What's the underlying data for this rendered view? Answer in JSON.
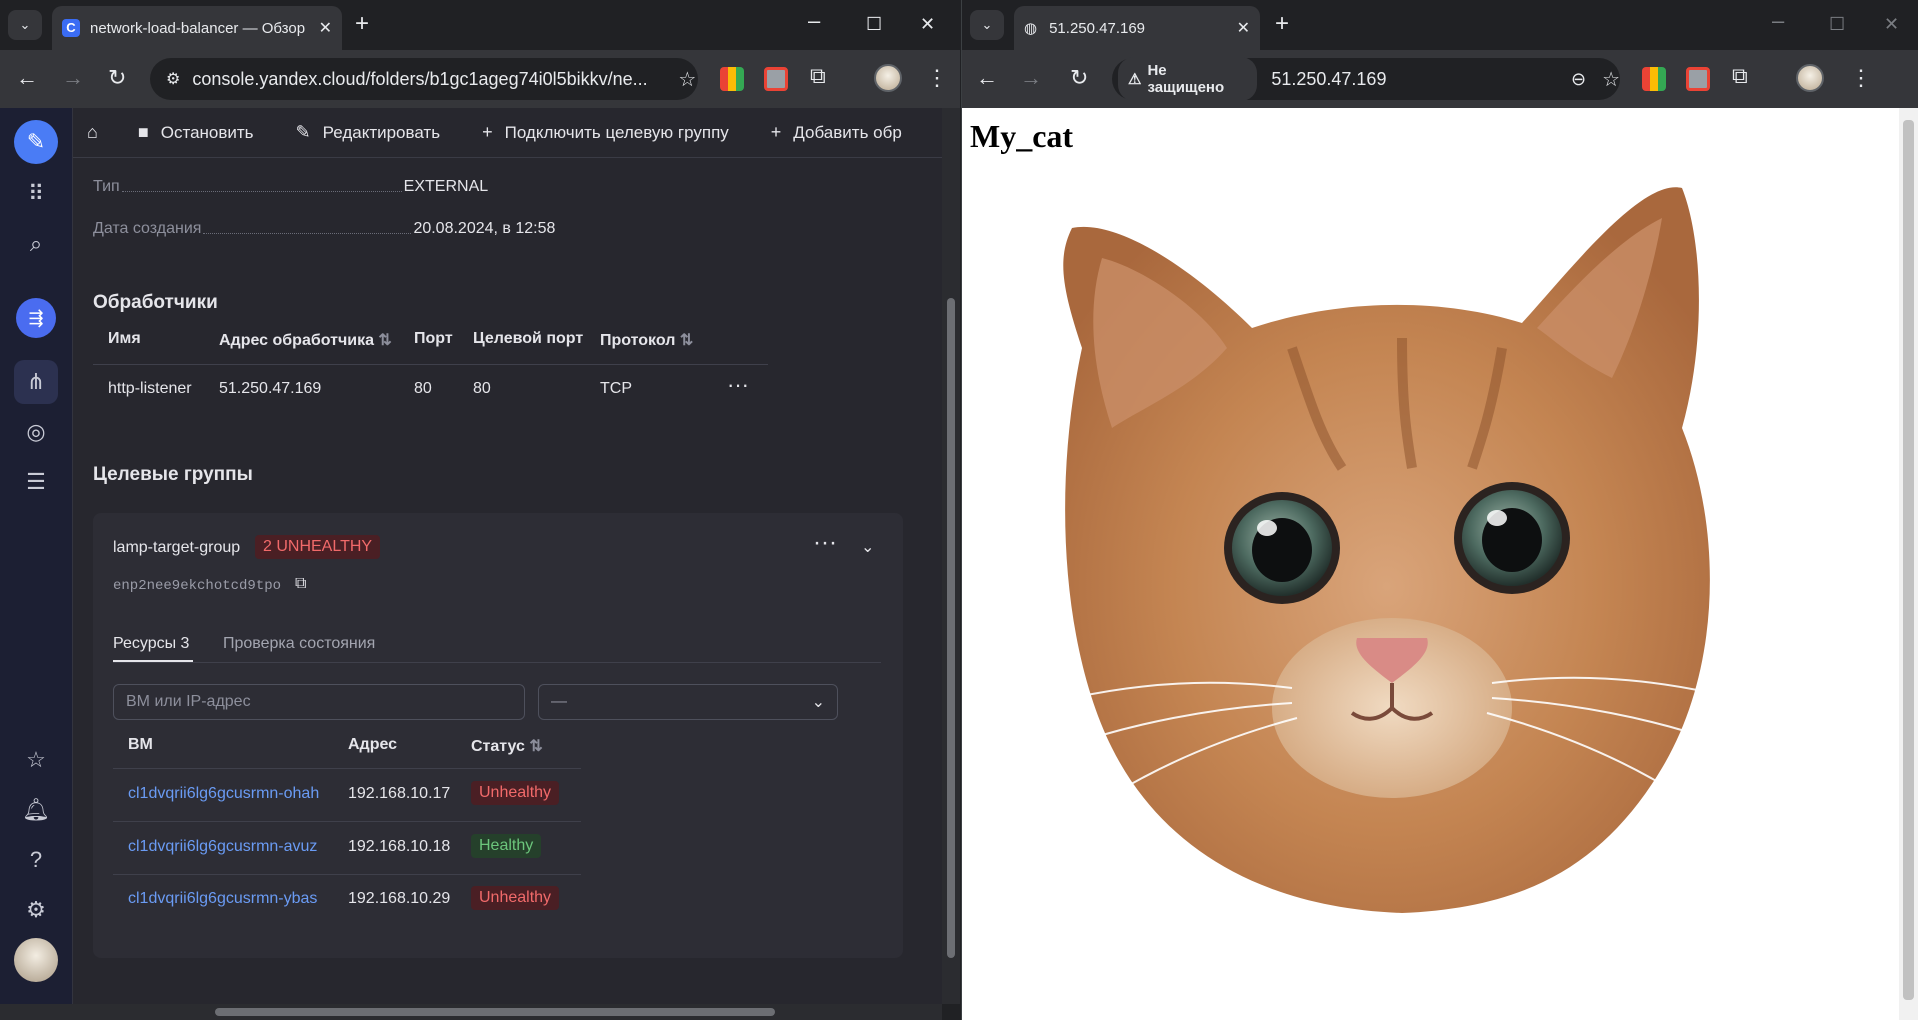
{
  "left_window": {
    "tab_title": "network-load-balancer — Обзор",
    "url": "console.yandex.cloud/folders/b1gc1ageg74i0l5bikkv/ne...",
    "actions": [
      "Остановить",
      "Редактировать",
      "Подключить целевую группу",
      "Добавить обр"
    ],
    "properties": [
      {
        "label": "Тип",
        "value": "EXTERNAL"
      },
      {
        "label": "Дата создания",
        "value": "20.08.2024, в 12:58"
      }
    ],
    "listeners": {
      "title": "Обработчики",
      "columns": [
        "Имя",
        "Адрес обработчика",
        "Порт",
        "Целевой порт",
        "Протокол"
      ],
      "rows": [
        {
          "name": "http-listener",
          "address": "51.250.47.169",
          "port": "80",
          "target_port": "80",
          "protocol": "TCP"
        }
      ]
    },
    "target_groups": {
      "title": "Целевые группы",
      "group_name": "lamp-target-group",
      "status_badge": "2 UNHEALTHY",
      "group_id": "enp2nee9ekchotcd9tpo",
      "tabs": [
        "Ресурсы 3",
        "Проверка состояния"
      ],
      "search_placeholder": "ВМ или IP-адрес",
      "select_value": "—",
      "columns": [
        "ВМ",
        "Адрес",
        "Статус"
      ],
      "rows": [
        {
          "vm": "cl1dvqrii6lg6gcusrmn-ohah",
          "address": "192.168.10.17",
          "status": "Unhealthy"
        },
        {
          "vm": "cl1dvqrii6lg6gcusrmn-avuz",
          "address": "192.168.10.18",
          "status": "Healthy"
        },
        {
          "vm": "cl1dvqrii6lg6gcusrmn-ybas",
          "address": "192.168.10.29",
          "status": "Unhealthy"
        }
      ]
    }
  },
  "right_window": {
    "tab_title": "51.250.47.169",
    "security_label": "Не защищено",
    "url": "51.250.47.169",
    "page_heading": "My_cat"
  },
  "colors": {
    "console_bg": "#27272e",
    "rail_bg": "#1c1f33",
    "link": "#6a9bf4",
    "unhealthy": "#f16a6a",
    "healthy": "#6cc57c"
  }
}
